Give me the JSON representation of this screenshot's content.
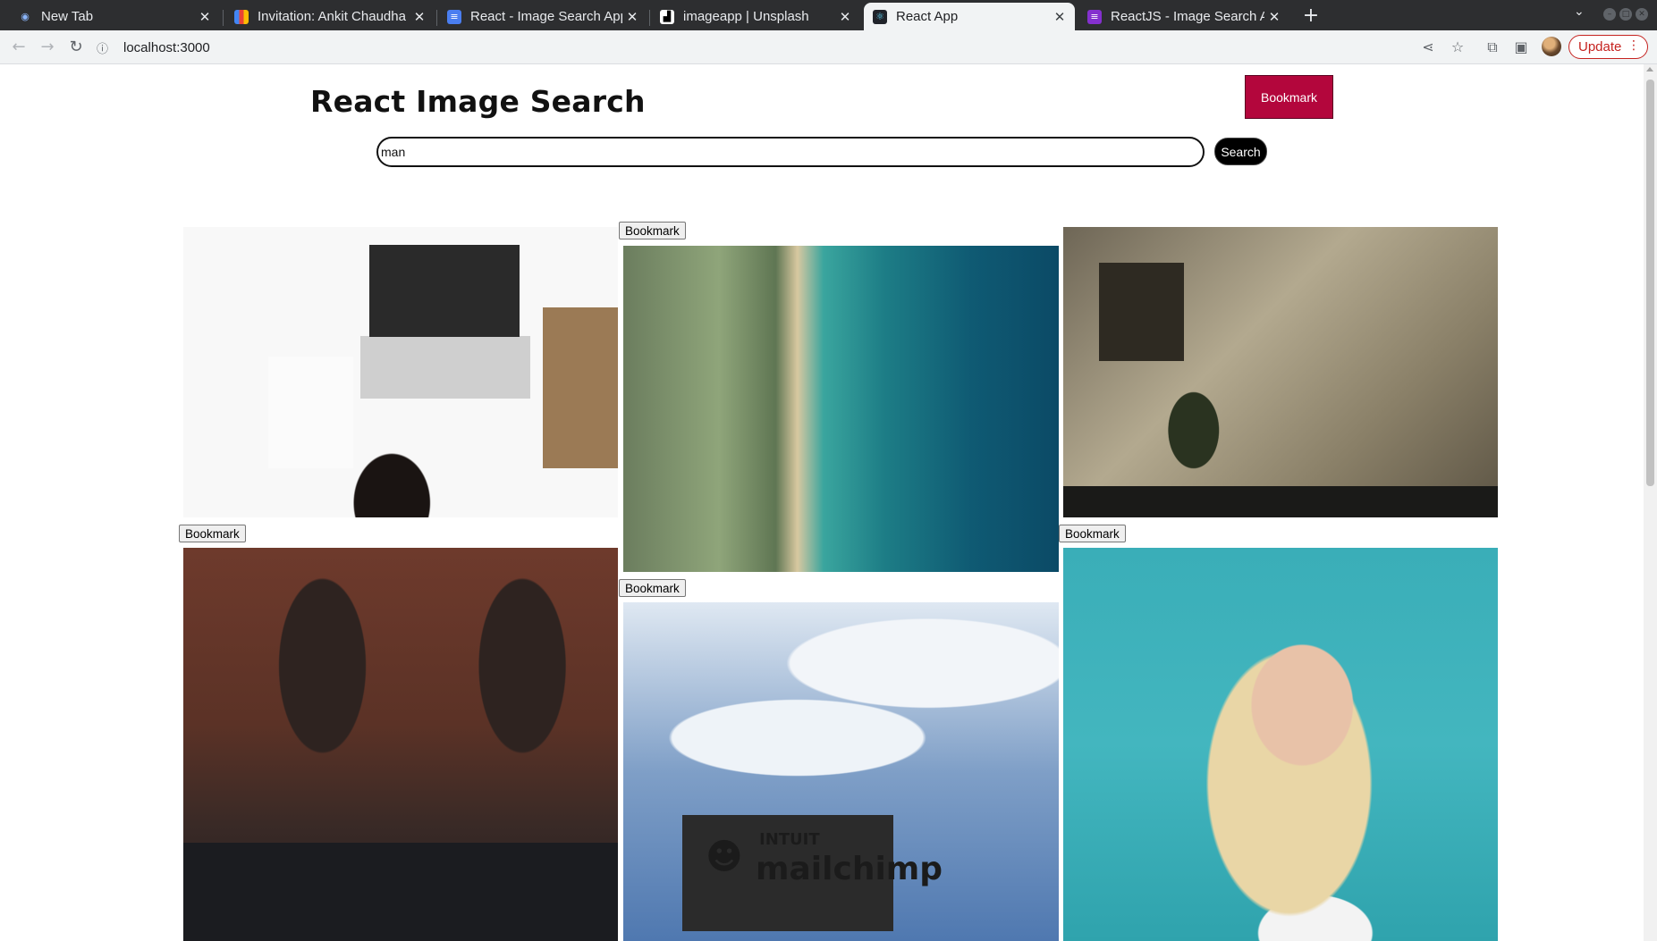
{
  "browser": {
    "tabs": [
      {
        "title": "New Tab",
        "favicon": "chrome-icon",
        "active": false
      },
      {
        "title": "Invitation: Ankit Chaudha",
        "favicon": "gmail-icon",
        "active": false
      },
      {
        "title": "React - Image Search App",
        "favicon": "docs-icon",
        "active": false
      },
      {
        "title": "imageapp | Unsplash",
        "favicon": "unsplash-icon",
        "active": false
      },
      {
        "title": "React App",
        "favicon": "react-icon",
        "active": true
      },
      {
        "title": "ReactJS - Image Search Ap",
        "favicon": "slides-icon",
        "active": false
      }
    ],
    "url": "localhost:3000",
    "update_label": "Update"
  },
  "page": {
    "title": "React Image Search",
    "bookmark_label": "Bookmark",
    "search": {
      "value": "man",
      "button_label": "Search"
    },
    "results": [
      {
        "subject": "Laptop on desk",
        "bookmark_label": "Bookmark"
      },
      {
        "subject": "Aerial coastline",
        "bookmark_label": "Bookmark"
      },
      {
        "subject": "Room with plants",
        "bookmark_label": "Bookmark"
      },
      {
        "subject": "Crowd in street",
        "bookmark_label": "Bookmark"
      },
      {
        "subject": "Mailchimp sign",
        "bookmark_label": "Bookmark",
        "sign_text": [
          "INTUIT",
          "mailchimp"
        ]
      },
      {
        "subject": "Birthday cake portrait",
        "bookmark_label": "Bookmark"
      }
    ]
  },
  "colors": {
    "bookmark_accent": "#b3063c",
    "search_button": "#000000",
    "update_accent": "#c5221f"
  }
}
